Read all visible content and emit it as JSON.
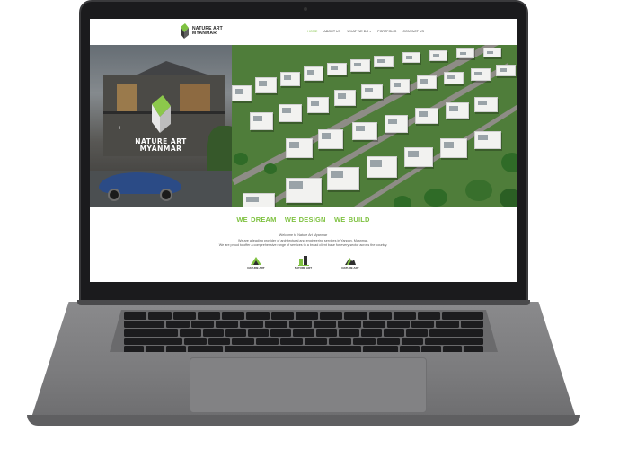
{
  "site": {
    "logo_text_line1": "NATURE ART",
    "logo_text_line2": "MYANMAR",
    "nav": [
      {
        "label": "HOME",
        "active": true
      },
      {
        "label": "ABOUT US",
        "active": false
      },
      {
        "label": "WHAT WE DO ▾",
        "active": false
      },
      {
        "label": "PORTFOLIO",
        "active": false
      },
      {
        "label": "CONTACT US",
        "active": false
      }
    ],
    "hero": {
      "logo_line1": "NATURE ART",
      "logo_line2": "MYANMAR",
      "prev_arrow": "‹"
    },
    "tagline": [
      "WE DREAM",
      "WE DESIGN",
      "WE BUILD"
    ],
    "intro": [
      "Welcome to Nature Art Myanmar",
      "We are a leading provider of architectural and engineering services in Yangon, Myanmar.",
      "We are proud to offer a comprehensive range of services to a broad client base for every sector across the country."
    ],
    "services": [
      {
        "icon": "construction-icon",
        "label": "NATURE ART"
      },
      {
        "icon": "architecture-icon",
        "label": "NATURE ART"
      },
      {
        "icon": "engineering-icon",
        "label": "NATURE ART"
      }
    ]
  },
  "colors": {
    "accent_green": "#7fc241",
    "laptop_frame": "#1b1b1d",
    "laptop_body": "#7b7b7d"
  }
}
